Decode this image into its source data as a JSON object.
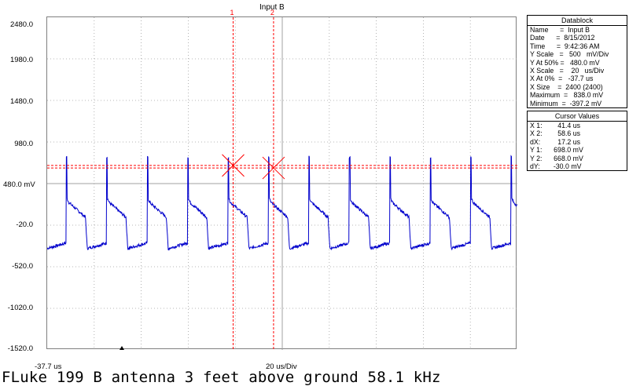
{
  "plot": {
    "title": "Input B",
    "y_tick_labels": [
      "2480.0",
      "1980.0",
      "1480.0",
      "980.0",
      "480.0 mV",
      "-20.0",
      "-520.0",
      "-1020.0",
      "-1520.0"
    ],
    "x_left_label": "-37.7 us",
    "x_scale_label": "20 us/Div",
    "cursor_labels": [
      "1",
      "2"
    ],
    "colors": {
      "trace": "#0000cc",
      "cursor": "#ff0000",
      "grid": "#a0a0a0"
    }
  },
  "datablock": {
    "title": "Datablock",
    "rows": [
      "Name      =  Input B",
      "Date      =  8/15/2012",
      "Time      =  9:42:36 AM",
      "Y Scale   =   500   mV/Div",
      "Y At 50% =   480.0 mV",
      "X Scale   =    20   us/Div",
      "X At 0%  =   -37.7 us",
      "X Size    =  2400 (2400)",
      "Maximum  =   838.0 mV",
      "Minimum  =  -397.2 mV"
    ]
  },
  "cursor_values": {
    "title": "Cursor Values",
    "rows": [
      "X 1:        41.4 us",
      "X 2:        58.6 us",
      "dX:         17.2 us",
      "Y 1:      698.0 mV",
      "Y 2:      668.0 mV",
      "dY:       -30.0 mV"
    ]
  },
  "caption": "FLuke 199 B antenna 3 feet above ground 58.1 kHz"
}
